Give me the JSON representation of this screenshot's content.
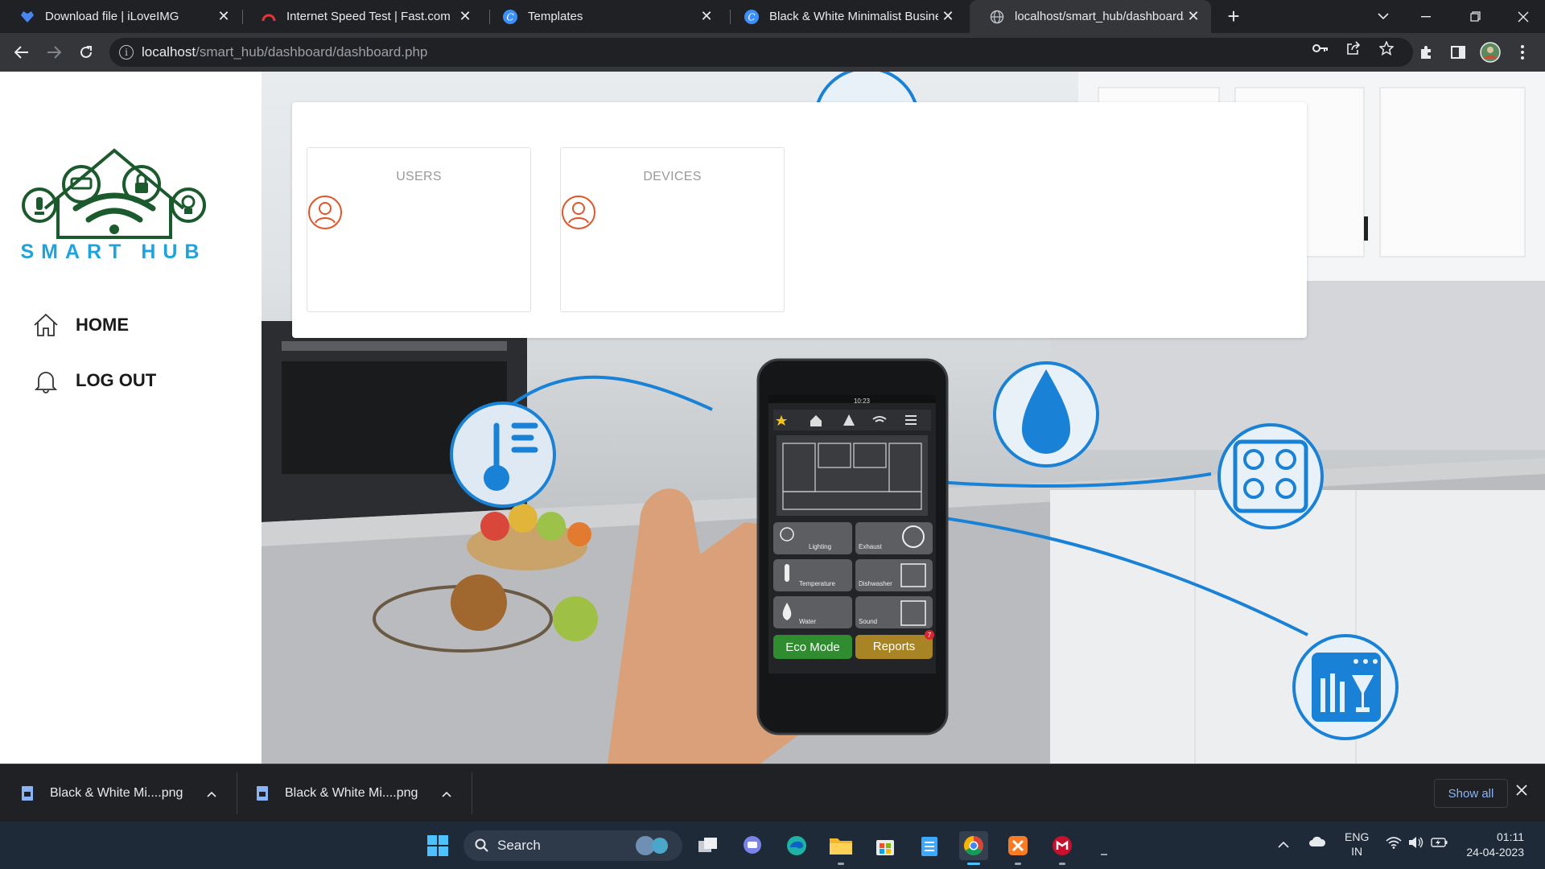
{
  "browser": {
    "tabs": [
      {
        "title": "Download file | iLoveIMG",
        "icon": "iloveimg-heart-icon",
        "active": false
      },
      {
        "title": "Internet Speed Test | Fast.com",
        "icon": "fast-speedometer-icon",
        "active": false
      },
      {
        "title": "Templates",
        "icon": "canva-icon",
        "active": false
      },
      {
        "title": "Black & White Minimalist Busines",
        "icon": "canva-icon",
        "active": false
      },
      {
        "title": "localhost/smart_hub/dashboard/",
        "icon": "globe-icon",
        "active": true
      }
    ],
    "url_host": "localhost",
    "url_path": "/smart_hub/dashboard/dashboard.php"
  },
  "sidebar": {
    "brand": "SMART HUB",
    "nav": [
      {
        "label": "HOME",
        "icon": "home-icon"
      },
      {
        "label": "LOG OUT",
        "icon": "bell-icon"
      }
    ]
  },
  "dashboard": {
    "tiles": [
      {
        "label": "USERS",
        "icon": "user-circle-icon"
      },
      {
        "label": "DEVICES",
        "icon": "user-circle-icon"
      }
    ]
  },
  "phone": {
    "time": "10:23",
    "buttons": [
      "Lighting",
      "Exhaust",
      "Temperature",
      "Dishwasher",
      "Water",
      "Sound"
    ],
    "eco": "Eco Mode",
    "reports": "Reports",
    "reports_badge": "7"
  },
  "downloads": {
    "items": [
      {
        "name": "Black & White Mi....png"
      },
      {
        "name": "Black & White Mi....png"
      }
    ],
    "show_all": "Show all"
  },
  "taskbar": {
    "search": "Search",
    "lang": "ENG",
    "region": "IN",
    "time": "01:11",
    "date": "24-04-2023"
  },
  "colors": {
    "brand_green": "#1b5a2c",
    "brand_blue": "#1fa3dd",
    "tile_icon": "#e0562b",
    "accent_blue": "#1a82d6"
  }
}
